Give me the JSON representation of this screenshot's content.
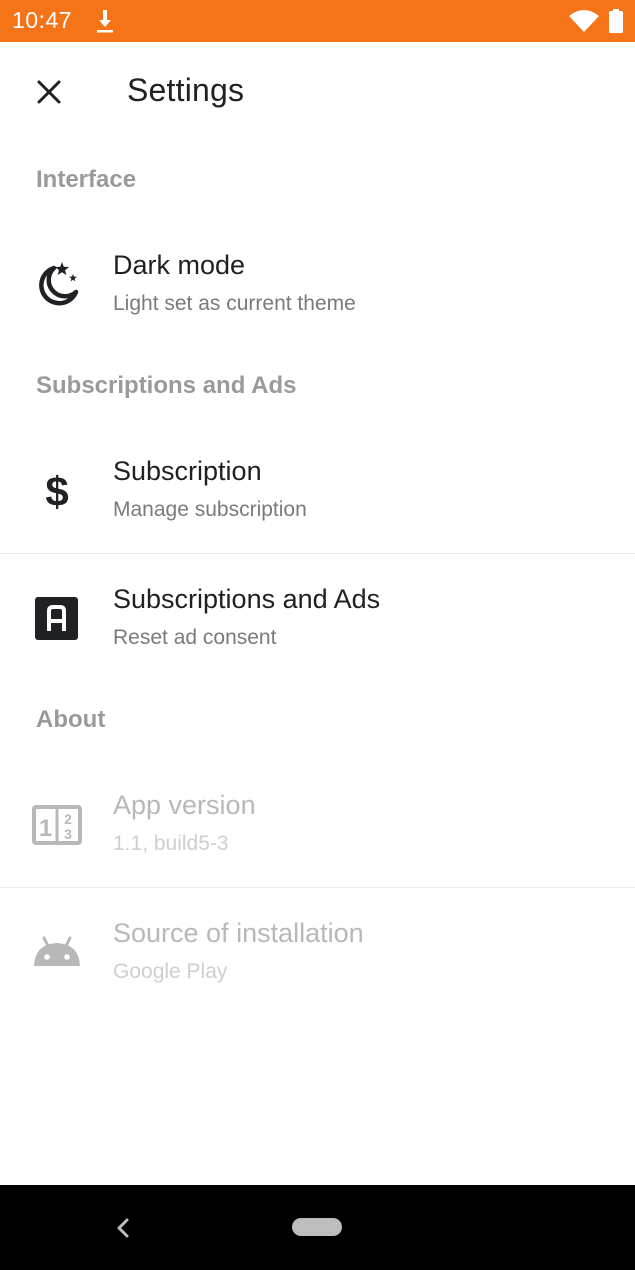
{
  "status_bar": {
    "time": "10:47",
    "icons": [
      "download-icon",
      "wifi-icon",
      "battery-icon"
    ],
    "background": "#f57418"
  },
  "app_bar": {
    "title": "Settings",
    "close_icon": "close-icon"
  },
  "sections": {
    "interface": {
      "header": "Interface",
      "dark_mode": {
        "title": "Dark mode",
        "subtitle": "Light set as current theme",
        "icon": "dark-mode-icon"
      }
    },
    "subscriptions": {
      "header": "Subscriptions and Ads",
      "subscription": {
        "title": "Subscription",
        "subtitle": "Manage subscription",
        "icon": "dollar-icon"
      },
      "ads": {
        "title": "Subscriptions and Ads",
        "subtitle": "Reset ad consent",
        "icon": "ad-icon"
      }
    },
    "about": {
      "header": "About",
      "app_version": {
        "title": "App version",
        "subtitle": "1.1, build5-3",
        "icon": "numbers-icon"
      },
      "install_source": {
        "title": "Source of installation",
        "subtitle": "Google Play",
        "icon": "android-icon"
      }
    }
  },
  "nav_bar": {
    "icons": [
      "back-icon",
      "home-pill-icon"
    ]
  },
  "colors": {
    "accent": "#f57418",
    "section_header": "#9a9a9a",
    "title_text": "#202124",
    "subtitle_text": "#7a7a7a",
    "disabled_text": "#b8b8b8"
  }
}
